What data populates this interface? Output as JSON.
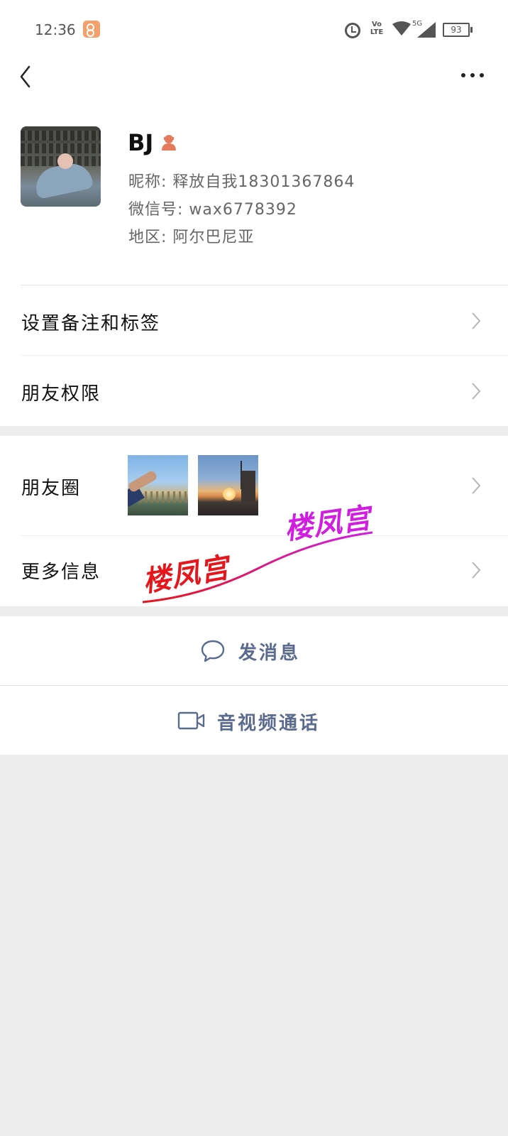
{
  "status_bar": {
    "time": "12:36",
    "network": "5G",
    "volte": "Vo LTE",
    "battery": "93"
  },
  "nav": {
    "back_icon": "chevron-left-icon",
    "more_icon": "more-dots-icon"
  },
  "profile": {
    "name": "BJ",
    "gender_icon": "female-icon",
    "nickname": "昵称: 释放自我18301367864",
    "wechat_id": "微信号: wax6778392",
    "region": "地区: 阿尔巴尼亚"
  },
  "cells": {
    "remark_tags": "设置备注和标签",
    "friend_permissions": "朋友权限",
    "moments": "朋友圈",
    "more_info": "更多信息"
  },
  "watermark": {
    "text_red": "楼凤宫",
    "text_purple": "楼凤宫",
    "color_red": "#e5161c",
    "color_purple": "#d01de0"
  },
  "actions": {
    "send_message": "发消息",
    "video_call": "音视频通话"
  },
  "colors": {
    "action_text": "#5b6b8f",
    "female_badge": "#e57b5d",
    "background": "#ededed"
  }
}
